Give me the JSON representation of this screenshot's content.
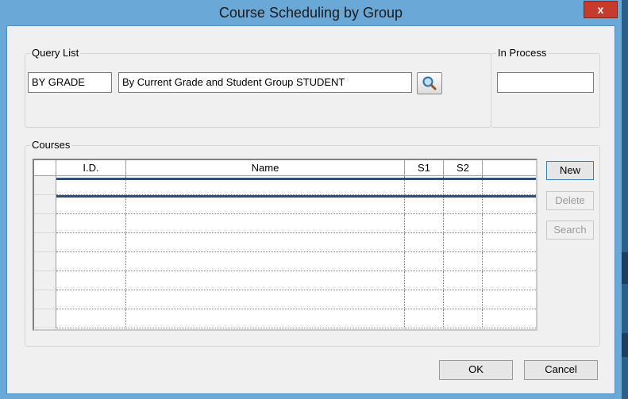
{
  "window": {
    "title": "Course Scheduling by Group",
    "close_label": "x"
  },
  "query_list": {
    "legend": "Query List",
    "code": "BY GRADE",
    "description": "By Current Grade and Student Group STUDENT",
    "search_icon": "magnifier-icon"
  },
  "in_process": {
    "legend": "In Process",
    "value": ""
  },
  "courses": {
    "legend": "Courses",
    "columns": [
      "I.D.",
      "Name",
      "S1",
      "S2",
      ""
    ],
    "rows": [
      [
        "",
        "",
        "",
        "",
        ""
      ],
      [
        "",
        "",
        "",
        "",
        ""
      ],
      [
        "",
        "",
        "",
        "",
        ""
      ],
      [
        "",
        "",
        "",
        "",
        ""
      ],
      [
        "",
        "",
        "",
        "",
        ""
      ],
      [
        "",
        "",
        "",
        "",
        ""
      ],
      [
        "",
        "",
        "",
        "",
        ""
      ],
      [
        "",
        "",
        "",
        "",
        ""
      ]
    ],
    "buttons": {
      "new": "New",
      "delete": "Delete",
      "search": "Search"
    }
  },
  "footer": {
    "ok": "OK",
    "cancel": "Cancel"
  },
  "colors": {
    "titlebar": "#6aa8d8",
    "close": "#c73b2c",
    "focus_row": "#2f4f78"
  }
}
